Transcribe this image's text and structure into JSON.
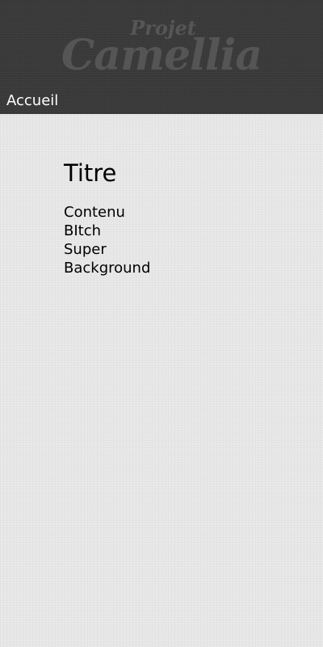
{
  "header": {
    "logo": {
      "top_text": "Projet",
      "main_text": "Camellia"
    },
    "nav": {
      "home_label": "Accueil"
    }
  },
  "main": {
    "title": "Titre",
    "lines": [
      "Contenu",
      "BItch",
      "Super",
      "Background"
    ]
  },
  "colors": {
    "header_bg": "#3a3a3a",
    "page_bg": "#e9e9e9",
    "logo_text": "#555555",
    "nav_text": "#ffffff"
  }
}
